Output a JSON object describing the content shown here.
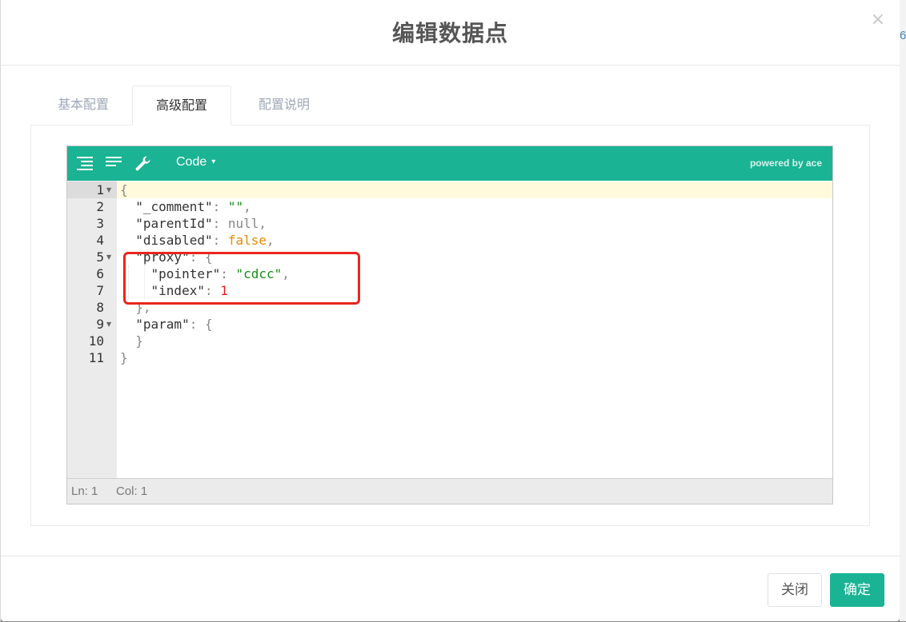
{
  "background": {
    "edge_text": "6"
  },
  "dialog": {
    "title": "编辑数据点",
    "close_glyph": "×"
  },
  "tabs": [
    {
      "label": "基本配置",
      "active": false
    },
    {
      "label": "高级配置",
      "active": true
    },
    {
      "label": "配置说明",
      "active": false
    }
  ],
  "editor": {
    "toolbar": {
      "format_icon": "format-icon",
      "compact_icon": "compact-icon",
      "repair_icon": "wrench-icon",
      "mode_label": "Code",
      "mode_caret": "▾",
      "powered_by": "powered by ace"
    },
    "line_numbers": [
      "1",
      "2",
      "3",
      "4",
      "5",
      "6",
      "7",
      "8",
      "9",
      "10",
      "11"
    ],
    "fold_markers": {
      "1": "▼",
      "5": "▼",
      "9": "▼"
    },
    "code_lines": [
      [
        {
          "t": "p",
          "v": "{"
        }
      ],
      [
        {
          "t": "i",
          "v": "  "
        },
        {
          "t": "key",
          "v": "\"_comment\""
        },
        {
          "t": "p",
          "v": ": "
        },
        {
          "t": "str",
          "v": "\"\""
        },
        {
          "t": "p",
          "v": ","
        }
      ],
      [
        {
          "t": "i",
          "v": "  "
        },
        {
          "t": "key",
          "v": "\"parentId\""
        },
        {
          "t": "p",
          "v": ": "
        },
        {
          "t": "nul",
          "v": "null"
        },
        {
          "t": "p",
          "v": ","
        }
      ],
      [
        {
          "t": "i",
          "v": "  "
        },
        {
          "t": "key",
          "v": "\"disabled\""
        },
        {
          "t": "p",
          "v": ": "
        },
        {
          "t": "bool",
          "v": "false"
        },
        {
          "t": "p",
          "v": ","
        }
      ],
      [
        {
          "t": "i",
          "v": "  "
        },
        {
          "t": "key",
          "v": "\"proxy\""
        },
        {
          "t": "p",
          "v": ": {"
        }
      ],
      [
        {
          "t": "i",
          "v": "    "
        },
        {
          "t": "key",
          "v": "\"pointer\""
        },
        {
          "t": "p",
          "v": ": "
        },
        {
          "t": "str",
          "v": "\"cdcc\""
        },
        {
          "t": "p",
          "v": ","
        }
      ],
      [
        {
          "t": "i",
          "v": "    "
        },
        {
          "t": "key",
          "v": "\"index\""
        },
        {
          "t": "p",
          "v": ": "
        },
        {
          "t": "num",
          "v": "1"
        }
      ],
      [
        {
          "t": "i",
          "v": "  "
        },
        {
          "t": "p",
          "v": "},"
        }
      ],
      [
        {
          "t": "i",
          "v": "  "
        },
        {
          "t": "key",
          "v": "\"param\""
        },
        {
          "t": "p",
          "v": ": {"
        }
      ],
      [
        {
          "t": "i",
          "v": "  "
        },
        {
          "t": "p",
          "v": "}"
        }
      ],
      [
        {
          "t": "p",
          "v": "}"
        }
      ]
    ],
    "status": {
      "line": "Ln: 1",
      "col": "Col: 1"
    }
  },
  "footer": {
    "close_label": "关闭",
    "confirm_label": "确定"
  },
  "colors": {
    "accent": "#1ab394",
    "highlight_border": "#e8271c"
  }
}
